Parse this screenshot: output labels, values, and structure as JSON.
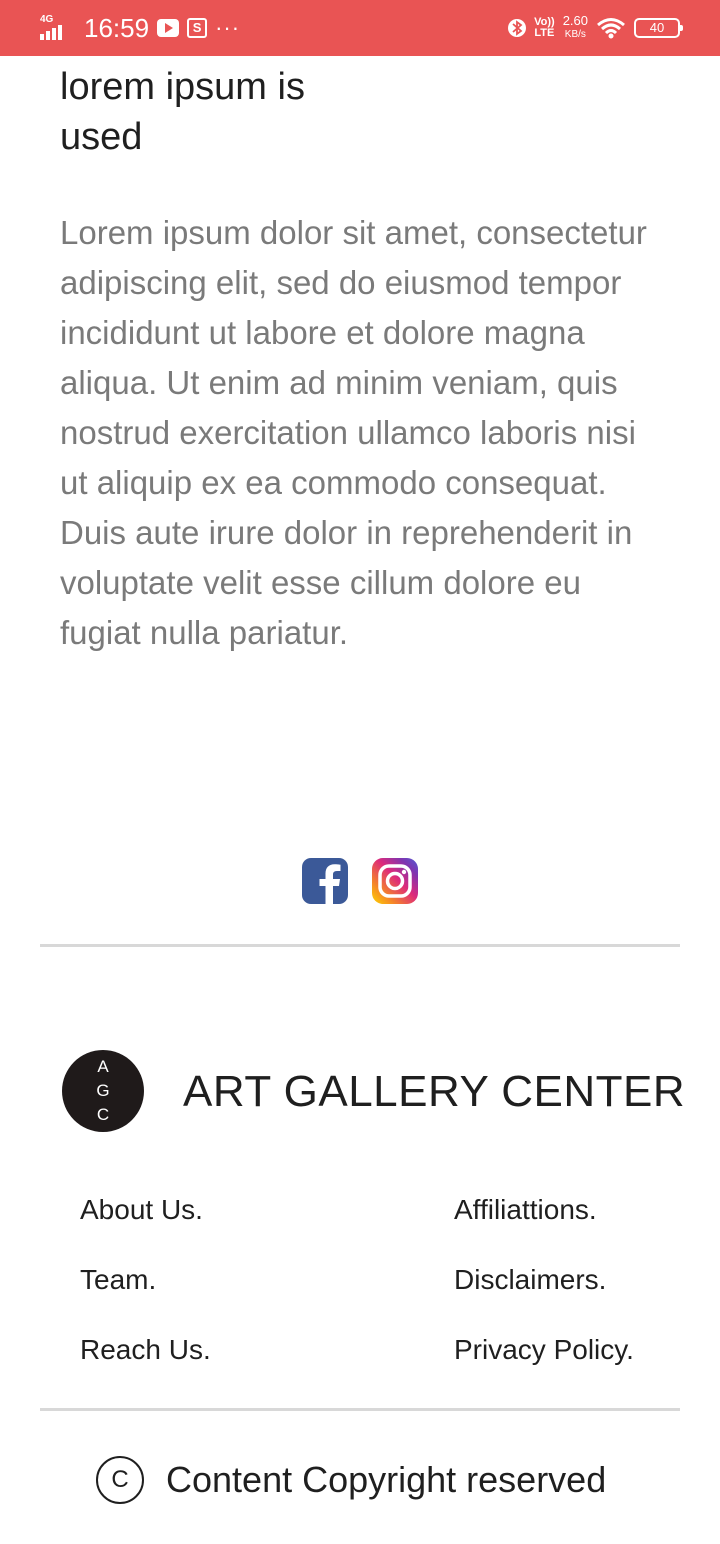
{
  "status_bar": {
    "network_tag": "4G",
    "time": "16:59",
    "more": "···",
    "volte_top": "Vo))",
    "volte_bottom": "LTE",
    "speed_value": "2.60",
    "speed_unit": "KB/s",
    "battery": "40"
  },
  "article": {
    "heading": "lorem ipsum is used",
    "body": "Lorem ipsum dolor sit amet, consectetur adipiscing elit, sed do eiusmod tempor incididunt ut labore et dolore magna aliqua. Ut enim ad minim veniam, quis nostrud exercitation ullamco laboris nisi ut aliquip ex ea commodo consequat. Duis aute irure dolor in reprehenderit in voluptate velit esse cillum dolore eu fugiat nulla pariatur."
  },
  "social": {
    "facebook_icon": "facebook-icon",
    "instagram_icon": "instagram-icon",
    "facebook_color": "#3b5998"
  },
  "footer": {
    "logo_letters": [
      "A",
      "G",
      "C"
    ],
    "brand_name": "ART GALLERY CENTER",
    "links_left": [
      "About Us.",
      "Team.",
      "Reach Us."
    ],
    "links_right": [
      "Affiliattions.",
      "Disclaimers.",
      "Privacy Policy."
    ],
    "copyright_symbol": "C",
    "copyright_text": "Content Copyright reserved"
  },
  "colors": {
    "status_bar": "#e95454",
    "heading_text": "#1f1f1f",
    "body_text": "#7a7a7a",
    "divider": "#d8d8d8",
    "logo_bg": "#1f1a1a"
  }
}
